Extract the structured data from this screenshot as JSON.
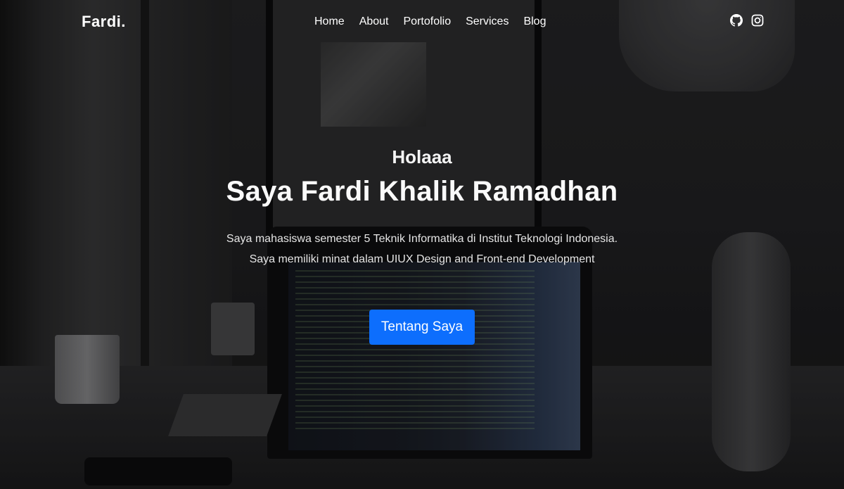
{
  "navbar": {
    "brand": "Fardi.",
    "links": [
      {
        "label": "Home"
      },
      {
        "label": "About"
      },
      {
        "label": "Portofolio"
      },
      {
        "label": "Services"
      },
      {
        "label": "Blog"
      }
    ],
    "socials": [
      {
        "icon": "github-icon"
      },
      {
        "icon": "instagram-icon"
      }
    ]
  },
  "hero": {
    "greeting": "Holaaa",
    "title": "Saya Fardi Khalik Ramadhan",
    "description_line1": "Saya mahasiswa semester 5 Teknik Informatika di Institut Teknologi Indonesia.",
    "description_line2": "Saya memiliki minat dalam UIUX Design and Front-end Development",
    "button_label": "Tentang Saya"
  },
  "colors": {
    "accent": "#0d6efd",
    "text": "#ffffff"
  }
}
